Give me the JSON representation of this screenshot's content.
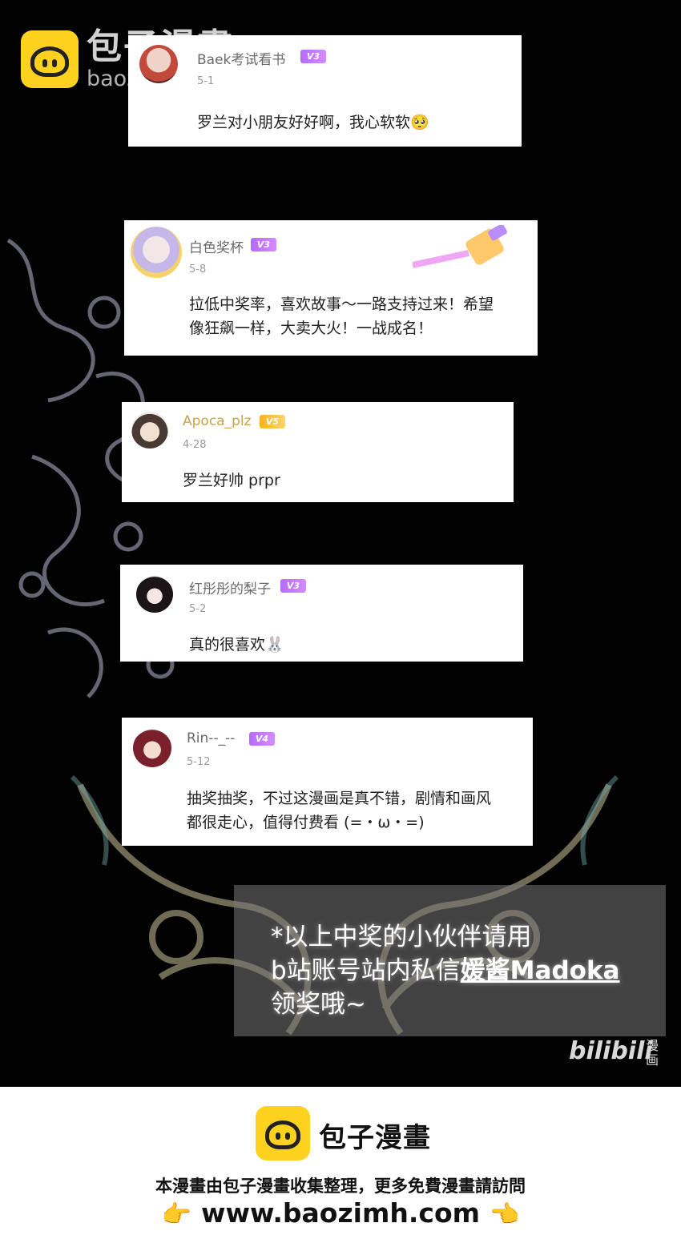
{
  "watermark": {
    "brand": "包子漫畫",
    "domain": "baozimh.com"
  },
  "comments": [
    {
      "username": "Baek考试看书",
      "level": "V3",
      "date": "5-1",
      "lines": [
        "罗兰对小朋友好好啊，我心软软🥺"
      ]
    },
    {
      "username": "白色奖杯",
      "level": "V3",
      "date": "5-8",
      "lines": [
        "拉低中奖率，喜欢故事～一路支持过来！希望",
        "像狂飙一样，大卖大火！一战成名！"
      ]
    },
    {
      "username": "Apoca_plz",
      "level": "V5",
      "date": "4-28",
      "lines": [
        "罗兰好帅 prpr"
      ]
    },
    {
      "username": "红彤彤的梨子",
      "level": "V3",
      "date": "5-2",
      "lines": [
        "真的很喜欢🐰"
      ]
    },
    {
      "username": "Rin--_--",
      "level": "V4",
      "date": "5-12",
      "lines": [
        "抽奖抽奖，不过这漫画是真不错，剧情和画风",
        "都很走心，值得付费看 (=・ω・=)"
      ]
    }
  ],
  "notice": {
    "line1": "*以上中奖的小伙伴请用",
    "line2_prefix": "b站账号站内私信",
    "line2_highlight": "媛酱Madoka",
    "line3": "领奖哦~"
  },
  "bilibili": {
    "logo": "bilibili",
    "side": "漫画"
  },
  "footer": {
    "brand": "包子漫畫",
    "description": "本漫畫由包子漫畫收集整理，更多免費漫畫請訪問",
    "url": "www.baozimh.com",
    "hand_left": "👉",
    "hand_right": "👈"
  },
  "colors": {
    "badge_purple": "#b66bff",
    "badge_gold": "#f5b320",
    "logo_yellow": "#ffd21f"
  }
}
